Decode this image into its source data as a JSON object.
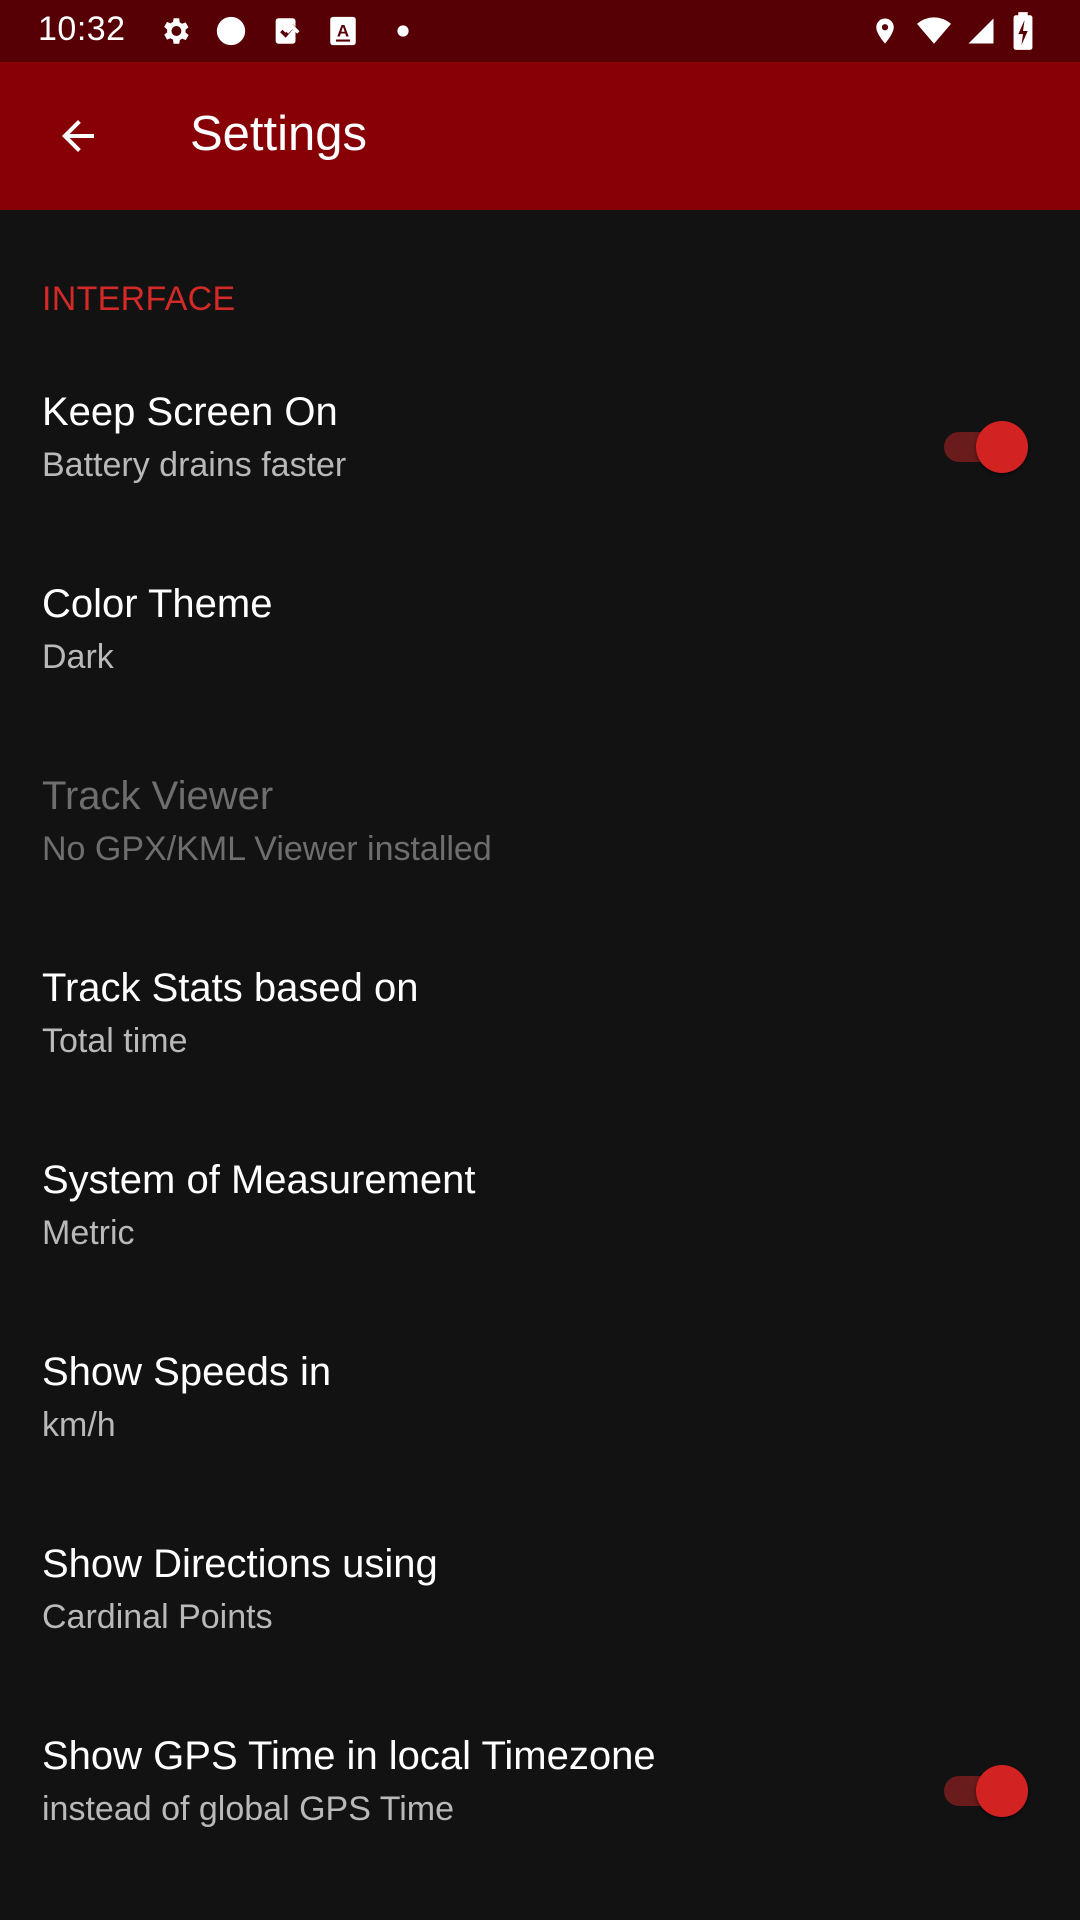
{
  "status_bar": {
    "time": "10:32",
    "left_icons": [
      "gear-icon",
      "circle-icon",
      "clipboard-check-icon",
      "text-box-icon",
      "dot-icon"
    ],
    "right_icons": [
      "location-icon",
      "wifi-icon",
      "signal-icon",
      "battery-charging-icon"
    ]
  },
  "toolbar": {
    "title": "Settings",
    "back_icon": "arrow-back-icon",
    "background": "#870006"
  },
  "colors": {
    "status_bar": "#560006",
    "accent": "#d32a28",
    "background": "#121212"
  },
  "category": {
    "label": "INTERFACE"
  },
  "preferences": [
    {
      "title": "Keep Screen On",
      "summary": "Battery drains faster",
      "switch": true,
      "checked": true,
      "enabled": true
    },
    {
      "title": "Color Theme",
      "summary": "Dark",
      "switch": false,
      "enabled": true
    },
    {
      "title": "Track Viewer",
      "summary": "No GPX/KML Viewer installed",
      "switch": false,
      "enabled": false
    },
    {
      "title": "Track Stats based on",
      "summary": "Total time",
      "switch": false,
      "enabled": true
    },
    {
      "title": "System of Measurement",
      "summary": "Metric",
      "switch": false,
      "enabled": true
    },
    {
      "title": "Show Speeds in",
      "summary": "km/h",
      "switch": false,
      "enabled": true
    },
    {
      "title": "Show Directions using",
      "summary": "Cardinal Points",
      "switch": false,
      "enabled": true
    },
    {
      "title": "Show GPS Time in local Timezone",
      "summary": "instead of global GPS Time",
      "switch": true,
      "checked": true,
      "enabled": true
    }
  ]
}
